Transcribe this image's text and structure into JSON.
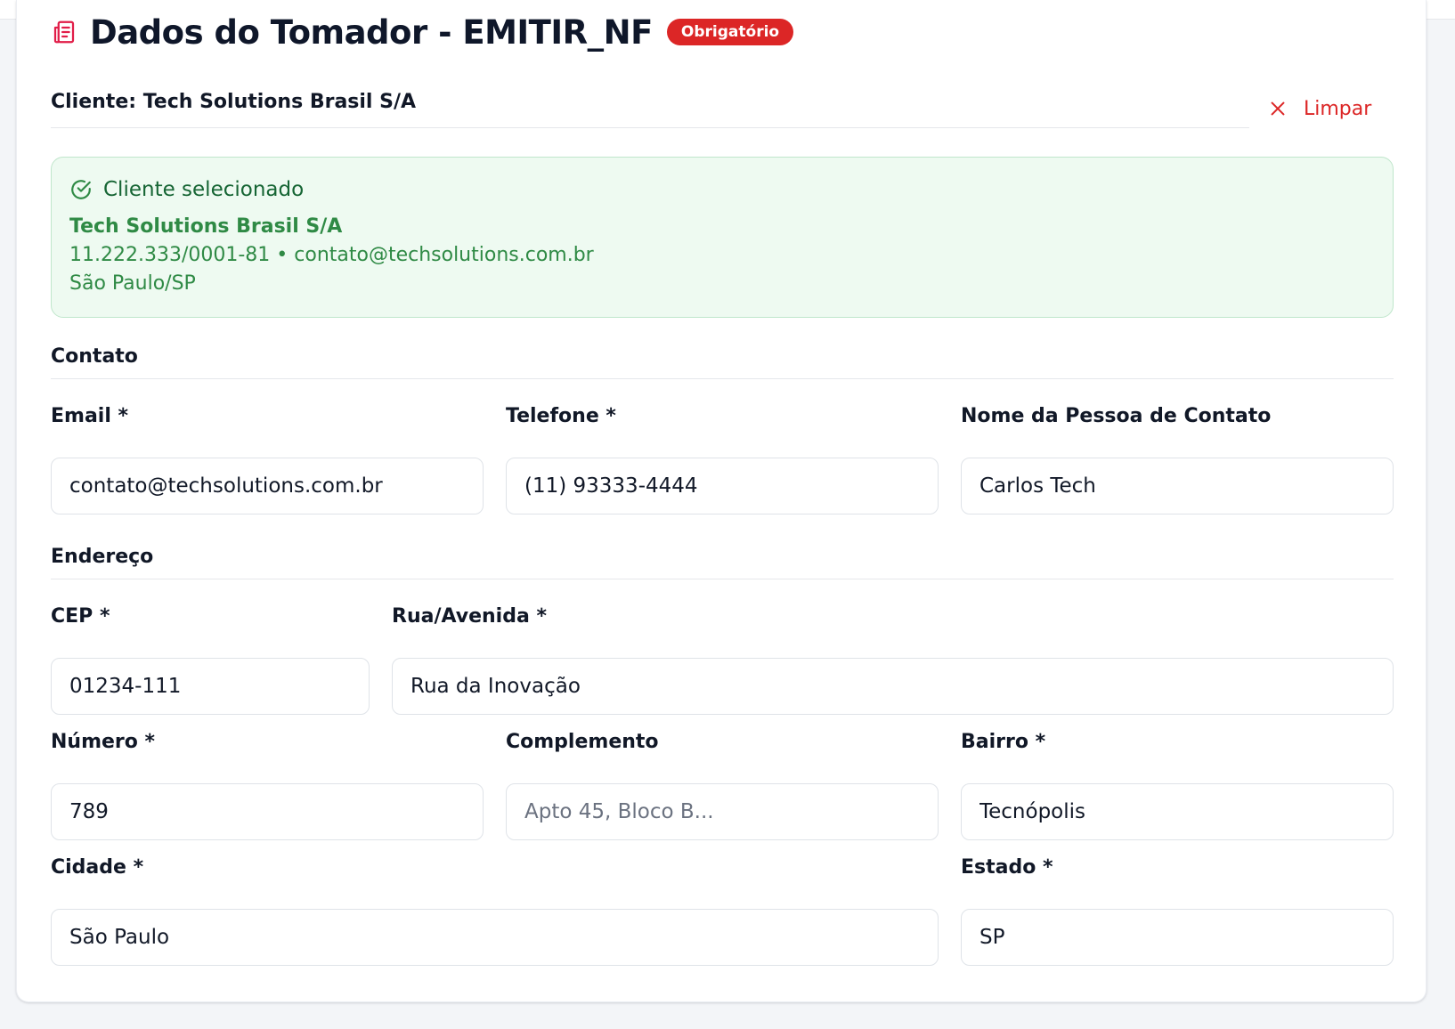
{
  "header": {
    "title": "Dados do Tomador - EMITIR_NF",
    "badge": "Obrigatório",
    "icon": "receipt-icon"
  },
  "client": {
    "label": "Cliente: Tech Solutions Brasil S/A",
    "clear_label": "Limpar"
  },
  "selected": {
    "heading": "Cliente selecionado",
    "name": "Tech Solutions Brasil S/A",
    "details": "11.222.333/0001-81 • contato@techsolutions.com.br",
    "location": "São Paulo/SP"
  },
  "contact": {
    "section_title": "Contato",
    "email_label": "Email *",
    "email_value": "contato@techsolutions.com.br",
    "phone_label": "Telefone *",
    "phone_value": "(11) 93333-4444",
    "person_label": "Nome da Pessoa de Contato",
    "person_value": "Carlos Tech"
  },
  "address": {
    "section_title": "Endereço",
    "cep_label": "CEP *",
    "cep_value": "01234-111",
    "street_label": "Rua/Avenida *",
    "street_value": "Rua da Inovação",
    "number_label": "Número *",
    "number_value": "789",
    "complement_label": "Complemento",
    "complement_value": "",
    "complement_placeholder": "Apto 45, Bloco B...",
    "district_label": "Bairro *",
    "district_value": "Tecnópolis",
    "city_label": "Cidade *",
    "city_value": "São Paulo",
    "state_label": "Estado *",
    "state_value": "SP"
  },
  "colors": {
    "accent_red": "#dc2626",
    "success_bg": "#eefaf1",
    "success_text": "#2f8a45"
  }
}
